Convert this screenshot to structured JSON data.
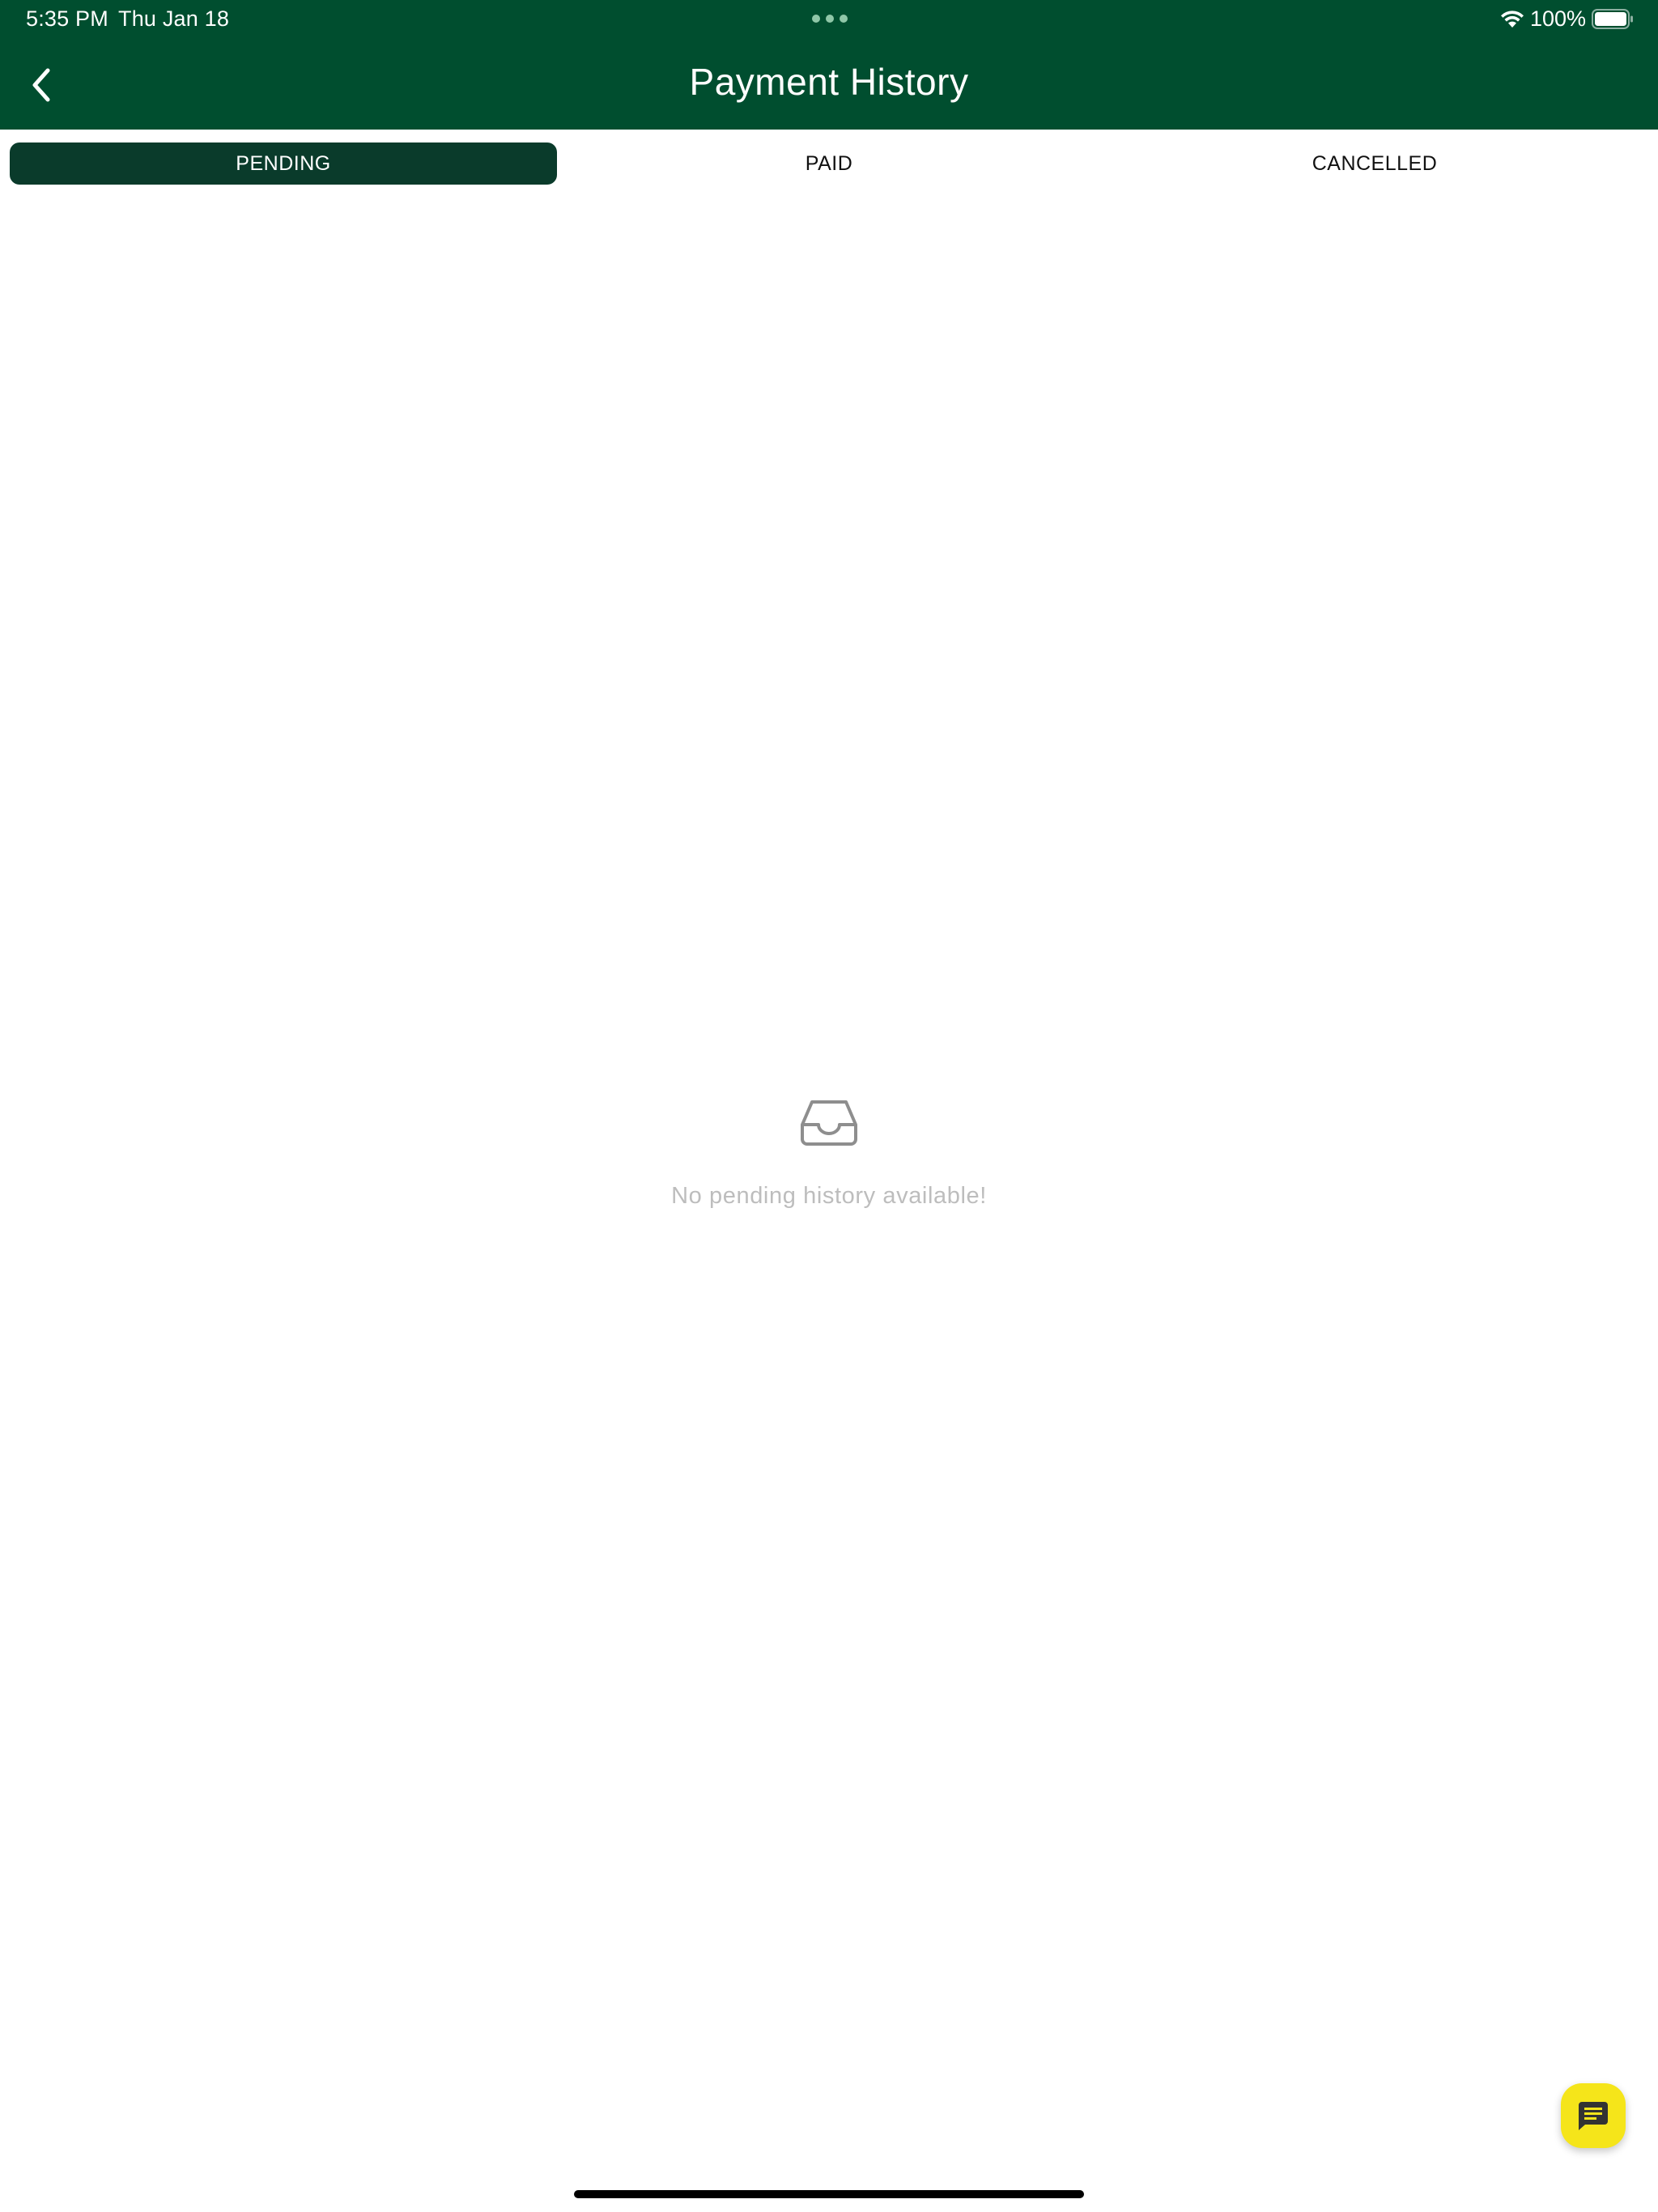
{
  "status_bar": {
    "time": "5:35 PM",
    "date": "Thu Jan 18",
    "battery": "100%"
  },
  "nav": {
    "title": "Payment History",
    "back_icon": "chevron-left-icon"
  },
  "tabs": [
    {
      "label": "PENDING",
      "selected": true
    },
    {
      "label": "PAID",
      "selected": false
    },
    {
      "label": "CANCELLED",
      "selected": false
    }
  ],
  "empty_state": {
    "icon": "inbox-icon",
    "message": "No pending history available!"
  },
  "fab": {
    "icon": "chat-icon"
  },
  "colors": {
    "header_bg": "#004e2f",
    "selected_tab_bg": "#0a3b2b",
    "fab_bg": "#f5e51a",
    "empty_text": "#bdbdbd"
  }
}
